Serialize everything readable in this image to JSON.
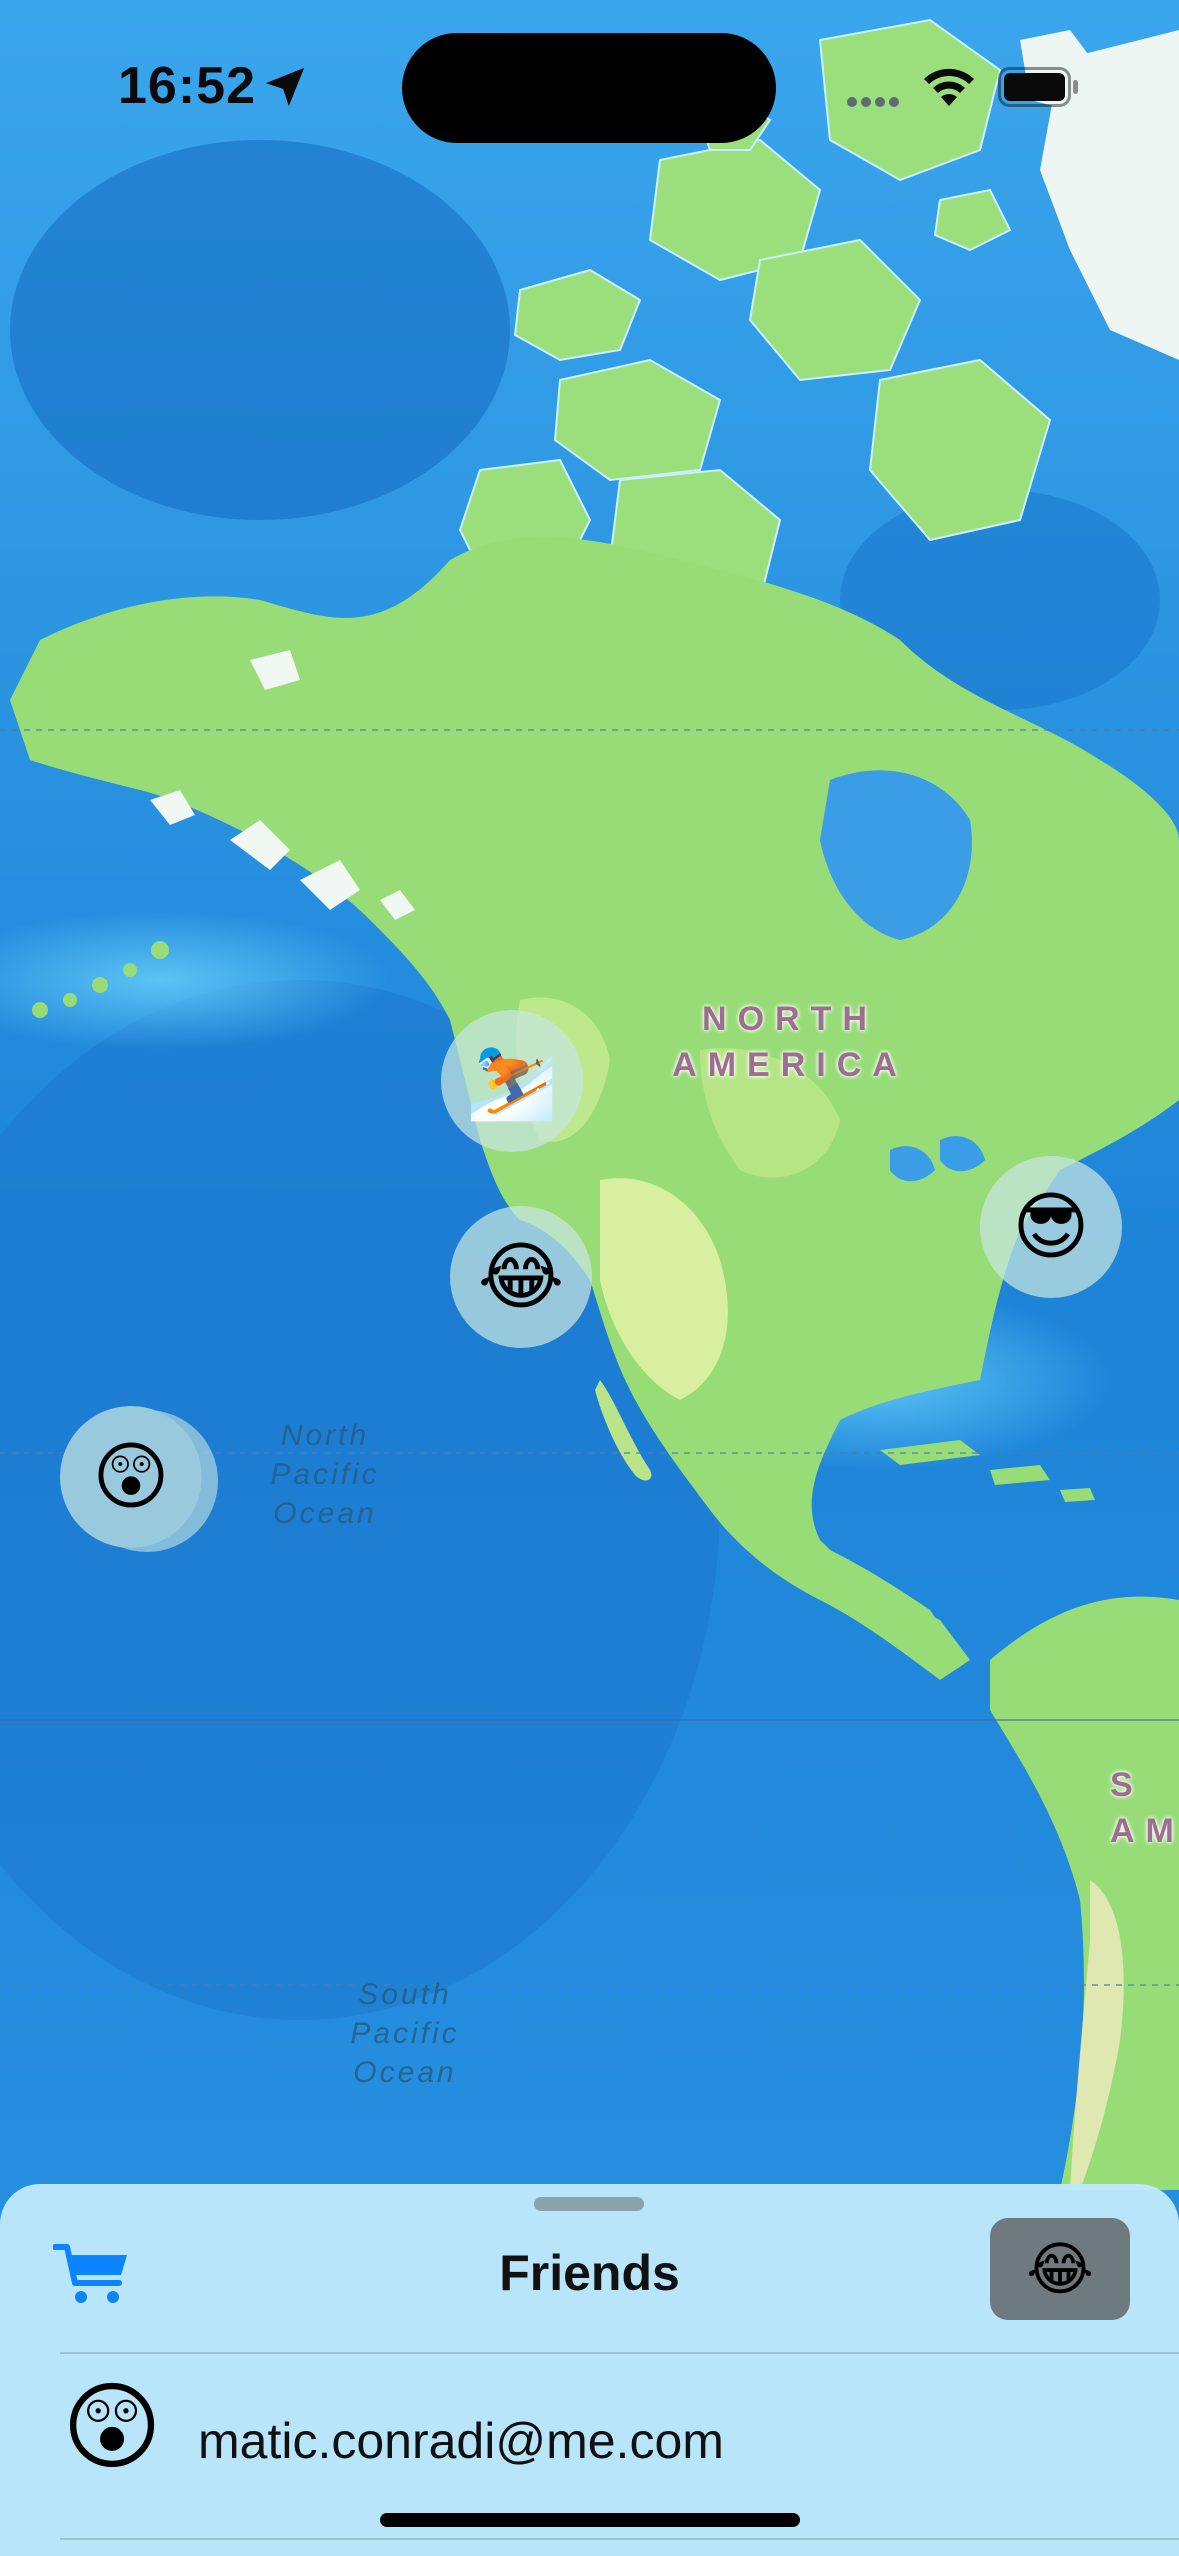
{
  "status_bar": {
    "time": "16:52",
    "icons": [
      "location-arrow-icon",
      "wifi-icon",
      "battery-icon"
    ]
  },
  "map": {
    "labels": {
      "continent_north_america": [
        "NORTH",
        "AMERICA"
      ],
      "continent_south_america_partial": [
        "S",
        "AM"
      ],
      "ocean_north_pacific": [
        "North",
        "Pacific",
        "Ocean"
      ],
      "ocean_south_pacific": [
        "South",
        "Pacific",
        "Ocean"
      ]
    },
    "pins": [
      {
        "name": "skier",
        "emoji": "⛷️"
      },
      {
        "name": "laughing",
        "emoji": "😂"
      },
      {
        "name": "sunglasses",
        "emoji": "😎"
      },
      {
        "name": "surprised",
        "emoji": "😲"
      }
    ],
    "colors": {
      "ocean": "#1f86d8",
      "land": "#98dd7a",
      "ice": "#f3f7f4"
    }
  },
  "sheet": {
    "title": "Friends",
    "cart_icon": "cart-icon",
    "my_status_emoji": "😂",
    "friends": [
      {
        "emoji": "😲",
        "email": "matic.conradi@me.com"
      }
    ],
    "accent_color": "#0a84ff"
  }
}
